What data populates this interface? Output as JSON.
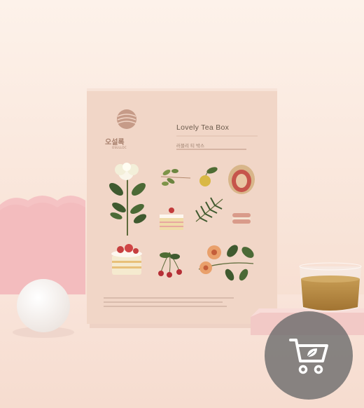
{
  "product": {
    "brand_name": "오설록",
    "brand_name_en": "OSULLOC",
    "box_title": "Lovely Tea Box",
    "box_subtitle": "러블리 티 박스"
  },
  "icons": {
    "cart": "cart-leaf-icon"
  },
  "colors": {
    "background": "#fbeee6",
    "box": "#f1d6c7",
    "cart_button": "#6e6e6e"
  }
}
